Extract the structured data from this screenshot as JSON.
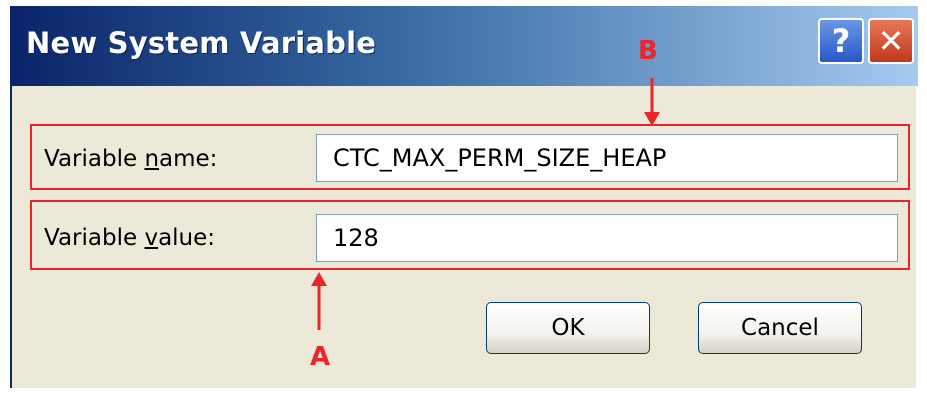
{
  "dialog": {
    "title": "New System Variable",
    "help_button": "?",
    "close_button": "✕"
  },
  "fields": {
    "name_label_pre": "Variable ",
    "name_label_accel": "n",
    "name_label_post": "ame:",
    "name_value": "CTC_MAX_PERM_SIZE_HEAP",
    "value_label_pre": "Variable ",
    "value_label_accel": "v",
    "value_label_post": "alue:",
    "value_value": "128"
  },
  "buttons": {
    "ok": "OK",
    "cancel": "Cancel"
  },
  "annotations": {
    "label_b": "B",
    "label_a": "A",
    "color": "#e8262b"
  },
  "icons": {
    "help": "question-mark-icon",
    "close": "close-x-icon"
  }
}
